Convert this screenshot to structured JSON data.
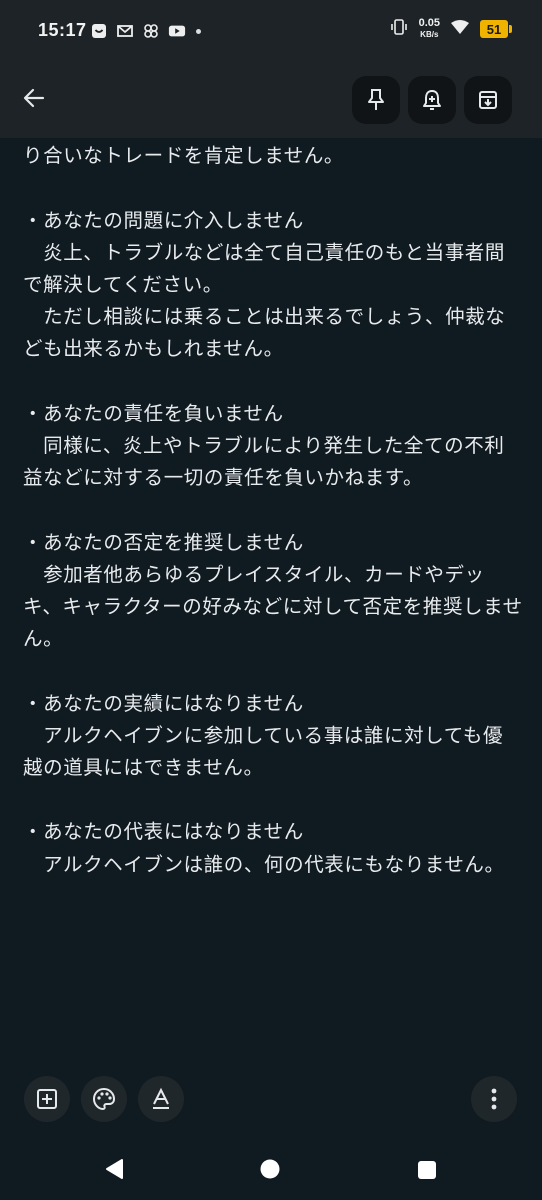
{
  "status": {
    "time": "15:17",
    "net_speed": "0.05",
    "net_unit": "KB/s",
    "battery": "51"
  },
  "icons": {
    "back": "arrow-back-icon",
    "pin": "pin-icon",
    "reminder": "reminder-bell-icon",
    "archive": "archive-icon",
    "add": "add-box-icon",
    "palette": "palette-icon",
    "text_format": "text-format-icon",
    "more": "more-vert-icon"
  },
  "colors": {
    "background": "#101a21",
    "toolbar": "#1d2326",
    "battery": "#f0b400"
  },
  "note": {
    "text": "・デュエリストにおける不正やカツアゲ、恐喝、不釣り合いなトレードを肯定しません。\n\n・あなたの問題に介入しません\n　炎上、トラブルなどは全て自己責任のもと当事者間で解決してください。\n　ただし相談には乗ることは出来るでしょう、仲裁なども出来るかもしれません。\n\n・あなたの責任を負いません\n　同様に、炎上やトラブルにより発生した全ての不利益などに対する一切の責任を負いかねます。\n\n・あなたの否定を推奨しません\n　参加者他あらゆるプレイスタイル、カードやデッキ、キャラクターの好みなどに対して否定を推奨しません。\n\n・あなたの実績にはなりません\n　アルクヘイブンに参加している事は誰に対しても優越の道具にはできません。\n\n・あなたの代表にはなりません\n　アルクヘイブンは誰の、何の代表にもなりません。"
  }
}
